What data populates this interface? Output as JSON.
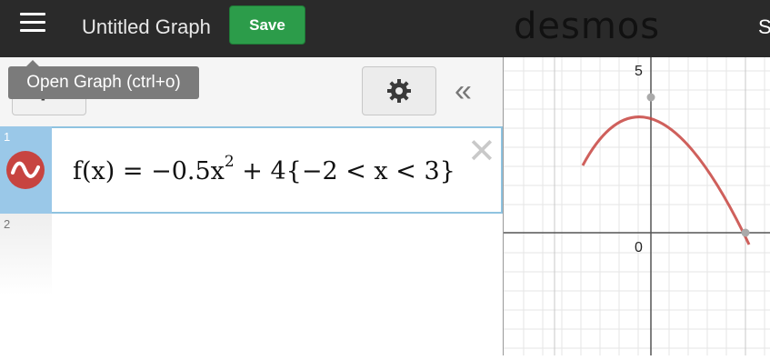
{
  "topbar": {
    "title": "Untitled Graph",
    "save_label": "Save",
    "brand": "desmos",
    "user_initial": "S"
  },
  "toolbar": {
    "tooltip": "Open Graph (ctrl+o)",
    "add_icon": "plus-icon",
    "settings_icon": "gear-icon",
    "collapse_icon": "double-chevron-left-icon"
  },
  "expressions": [
    {
      "number": "1",
      "math_main": "f(x) = −0.5x",
      "math_exp": "2",
      "math_rest": " + 4{−2 < x < 3}",
      "color": "#c74440"
    },
    {
      "number": "2"
    }
  ],
  "graph": {
    "y_tick_top": "5",
    "origin_label": "0",
    "curve_color": "#c74440"
  }
}
